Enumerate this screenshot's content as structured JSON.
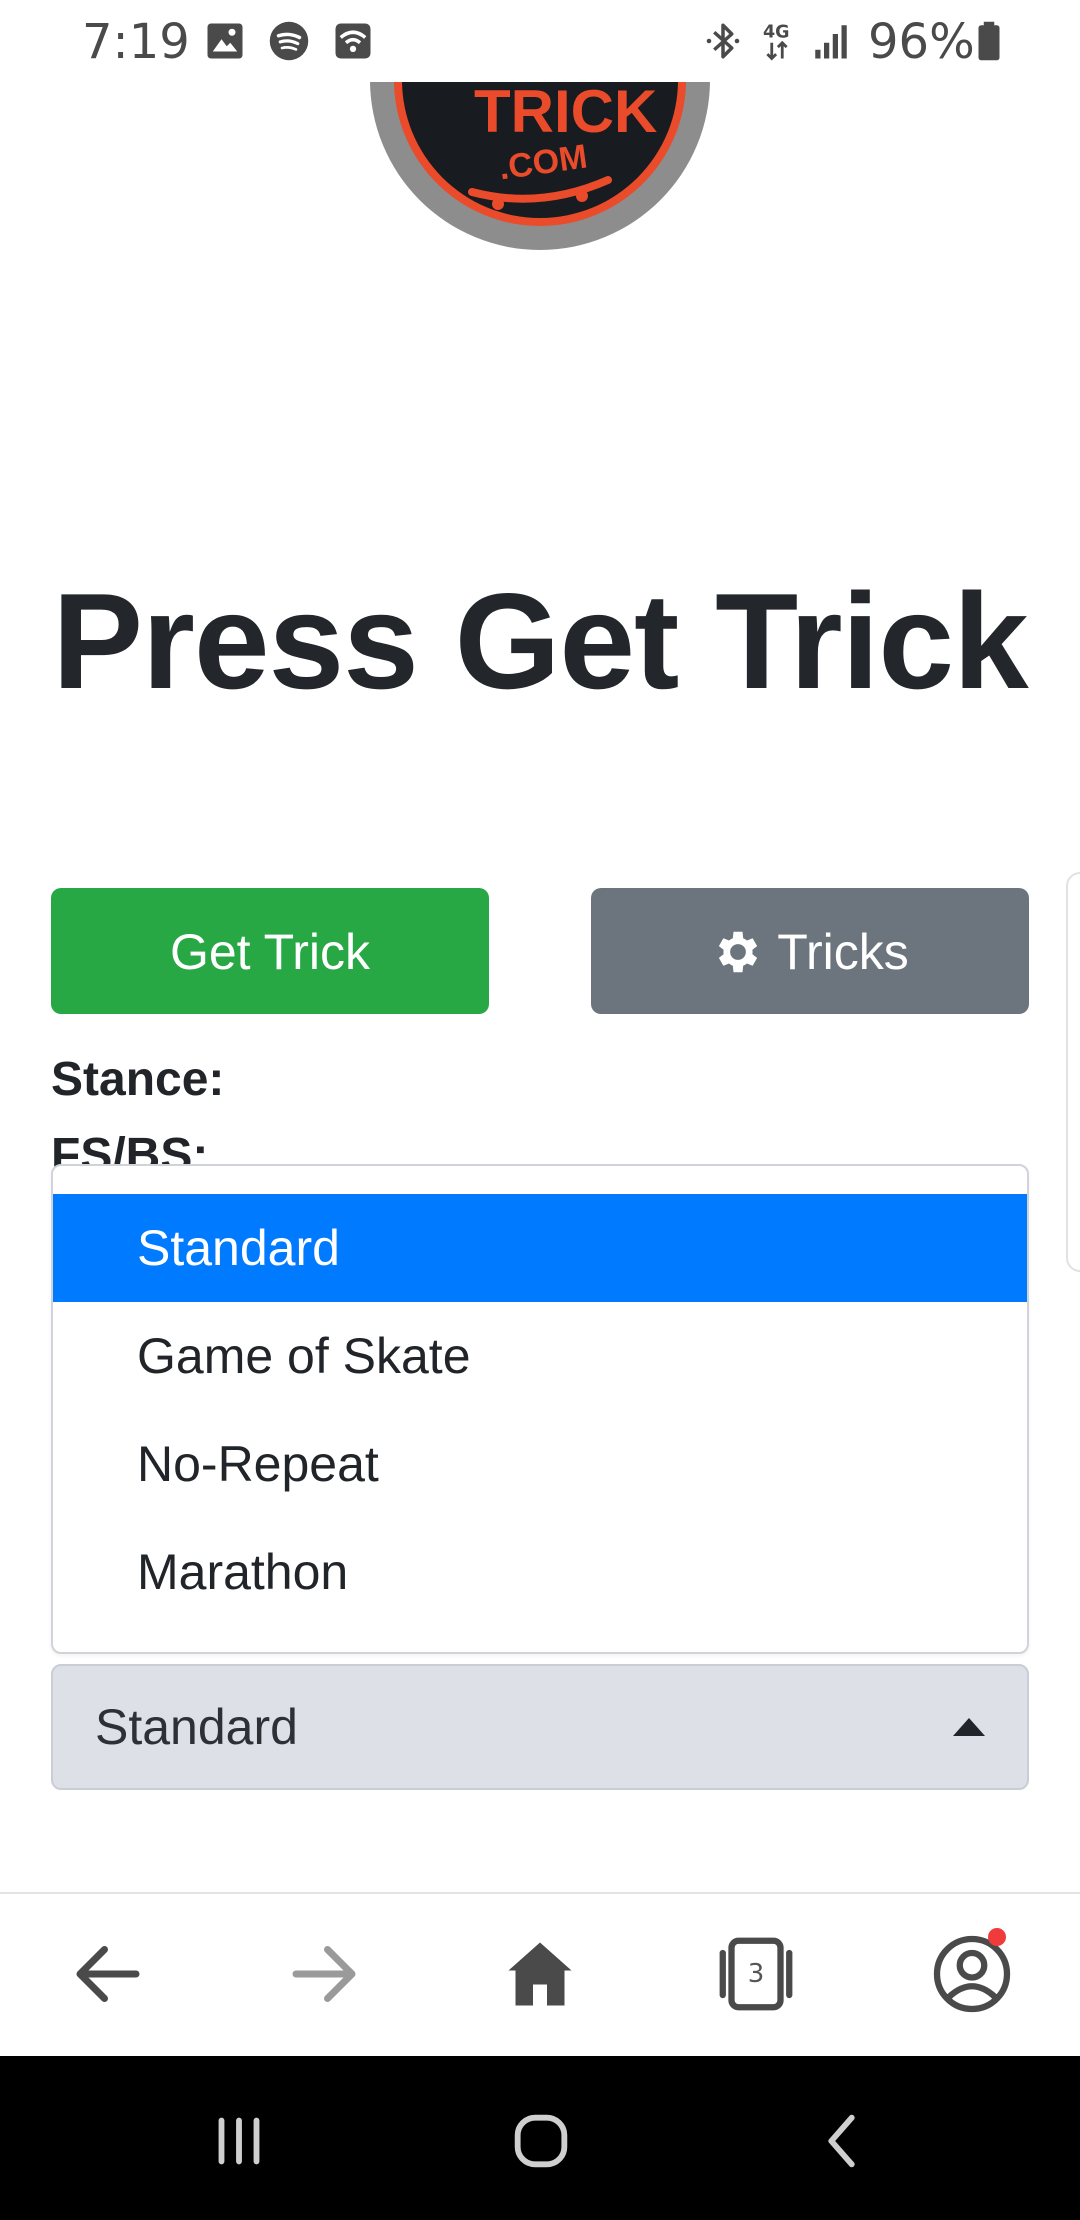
{
  "status_bar": {
    "time": "7:19",
    "battery_percent": "96%",
    "icons": [
      "gallery-icon",
      "spotify-icon",
      "wifi-icon",
      "bluetooth-icon",
      "network-4g-icon",
      "signal-icon",
      "battery-icon"
    ]
  },
  "logo": {
    "alt": "Trick .com"
  },
  "headline": "Press Get Trick",
  "buttons": {
    "get_trick": "Get Trick",
    "tricks": "Tricks",
    "tricks_icon": "gear-icon"
  },
  "labels": {
    "stance": "Stance:",
    "fs_bs": "FS/BS:"
  },
  "mode_select": {
    "value": "Standard",
    "options": [
      {
        "label": "Standard",
        "selected": true
      },
      {
        "label": "Game of Skate",
        "selected": false
      },
      {
        "label": "No-Repeat",
        "selected": false
      },
      {
        "label": "Marathon",
        "selected": false
      }
    ]
  },
  "browser_toolbar": {
    "tab_count": "3",
    "icons": [
      "back-arrow-icon",
      "forward-arrow-icon",
      "home-icon",
      "tabs-icon",
      "profile-icon"
    ]
  },
  "colors": {
    "get_trick_button": "#28a745",
    "tricks_button": "#6c757d",
    "selected_option": "#007bff",
    "select_background": "#dde1e7",
    "notification_dot": "#ef3b3b"
  }
}
